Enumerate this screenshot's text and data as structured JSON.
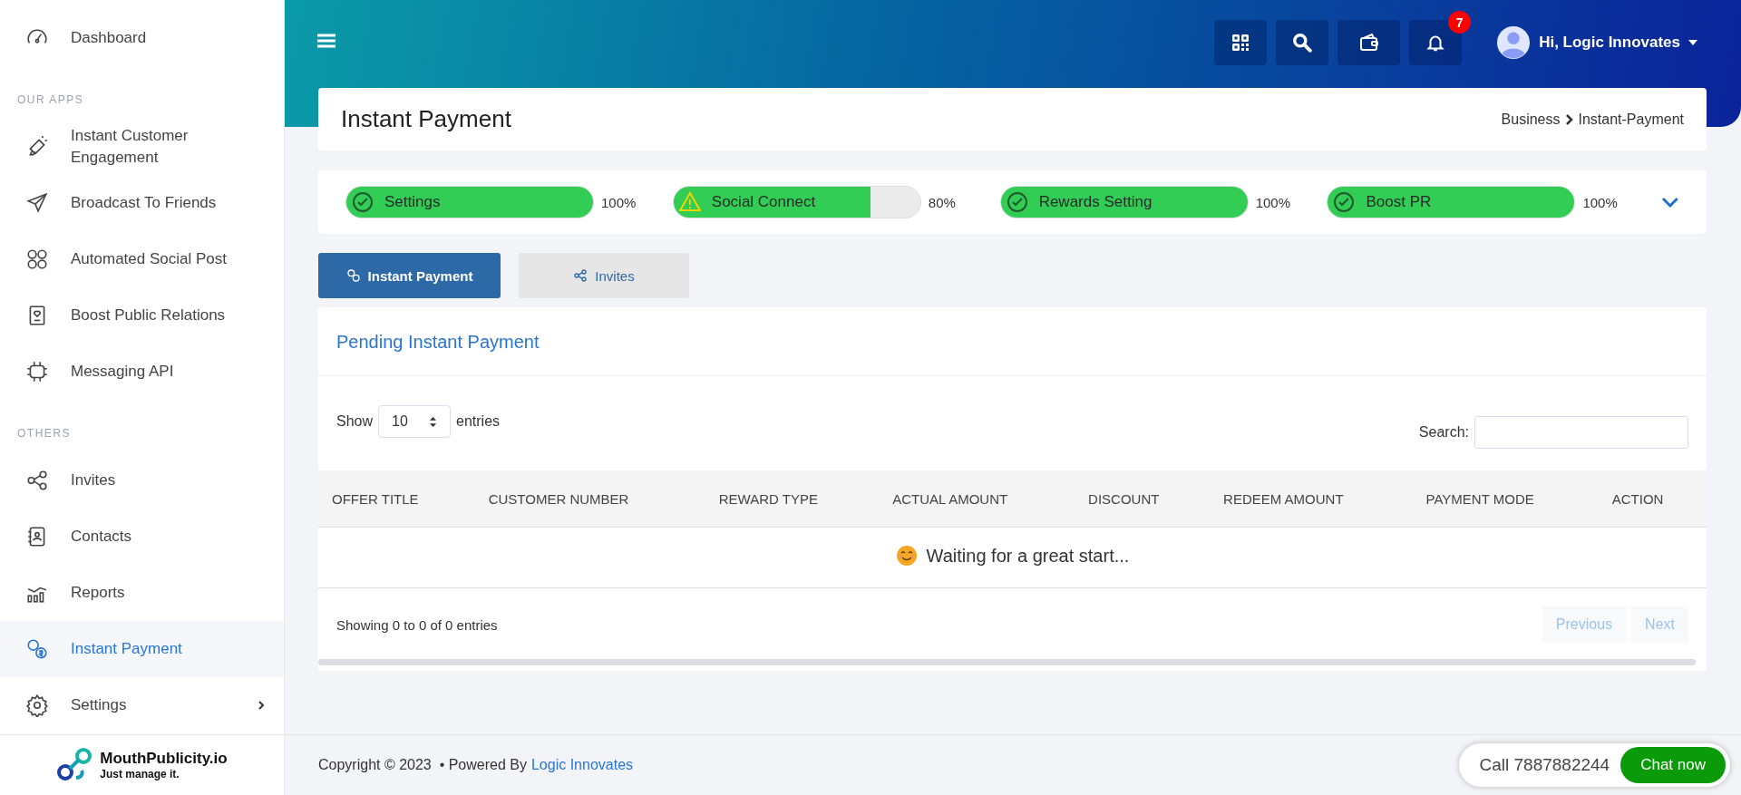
{
  "sidebar": {
    "items": [
      {
        "kind": "item",
        "label": "Dashboard",
        "selected": false,
        "submenu": false
      },
      {
        "kind": "section",
        "label": "OUR APPS"
      },
      {
        "kind": "item",
        "label": "Instant Customer Engagement",
        "selected": false,
        "submenu": false
      },
      {
        "kind": "item",
        "label": "Broadcast To Friends",
        "selected": false,
        "submenu": false
      },
      {
        "kind": "item",
        "label": "Automated Social Post",
        "selected": false,
        "submenu": false
      },
      {
        "kind": "item",
        "label": "Boost Public Relations",
        "selected": false,
        "submenu": false
      },
      {
        "kind": "item",
        "label": "Messaging API",
        "selected": false,
        "submenu": false
      },
      {
        "kind": "section",
        "label": "OTHERS"
      },
      {
        "kind": "item",
        "label": "Invites",
        "selected": false,
        "submenu": false
      },
      {
        "kind": "item",
        "label": "Contacts",
        "selected": false,
        "submenu": false
      },
      {
        "kind": "item",
        "label": "Reports",
        "selected": false,
        "submenu": false
      },
      {
        "kind": "item",
        "label": "Instant Payment",
        "selected": true,
        "submenu": false
      },
      {
        "kind": "item",
        "label": "Settings",
        "selected": false,
        "submenu": true
      }
    ],
    "logo": {
      "name": "MouthPublicity.io",
      "tagline": "Just manage it."
    }
  },
  "header": {
    "notifications": "7",
    "greeting": "Hi, Logic Innovates"
  },
  "page": {
    "title": "Instant Payment",
    "breadcrumb": [
      "Business",
      "Instant-Payment"
    ]
  },
  "progress": [
    {
      "label": "Settings",
      "kind": "complete",
      "level": 1,
      "reading": "100%"
    },
    {
      "label": "Social Connect",
      "kind": "warning",
      "level": 0.8,
      "reading": "80%"
    },
    {
      "label": "Rewards Setting",
      "kind": "complete",
      "level": 1,
      "reading": "100%"
    },
    {
      "label": "Boost PR",
      "kind": "complete",
      "level": 1,
      "reading": "100%"
    }
  ],
  "tabs": [
    {
      "label": "Instant Payment",
      "selected": true
    },
    {
      "label": "Invites",
      "selected": false
    }
  ],
  "table": {
    "title": "Pending Instant Payment",
    "show_label": "Show",
    "page_size": "10",
    "entries_label": "entries",
    "search_label": "Search:",
    "columns": [
      "OFFER TITLE",
      "CUSTOMER NUMBER",
      "REWARD TYPE",
      "ACTUAL AMOUNT",
      "DISCOUNT",
      "REDEEM AMOUNT",
      "PAYMENT MODE",
      "ACTION"
    ],
    "empty_message": "Waiting for a great start...",
    "info": "Showing 0 to 0 of 0 entries",
    "pagination": [
      {
        "label": "Previous",
        "disabled": true
      },
      {
        "label": "Next",
        "disabled": true
      }
    ]
  },
  "footer": {
    "copyright": "Copyright © 2023  • Powered By",
    "link": "Logic Innovates"
  },
  "chat": {
    "call": "Call 7887882244",
    "button": "Chat now"
  }
}
